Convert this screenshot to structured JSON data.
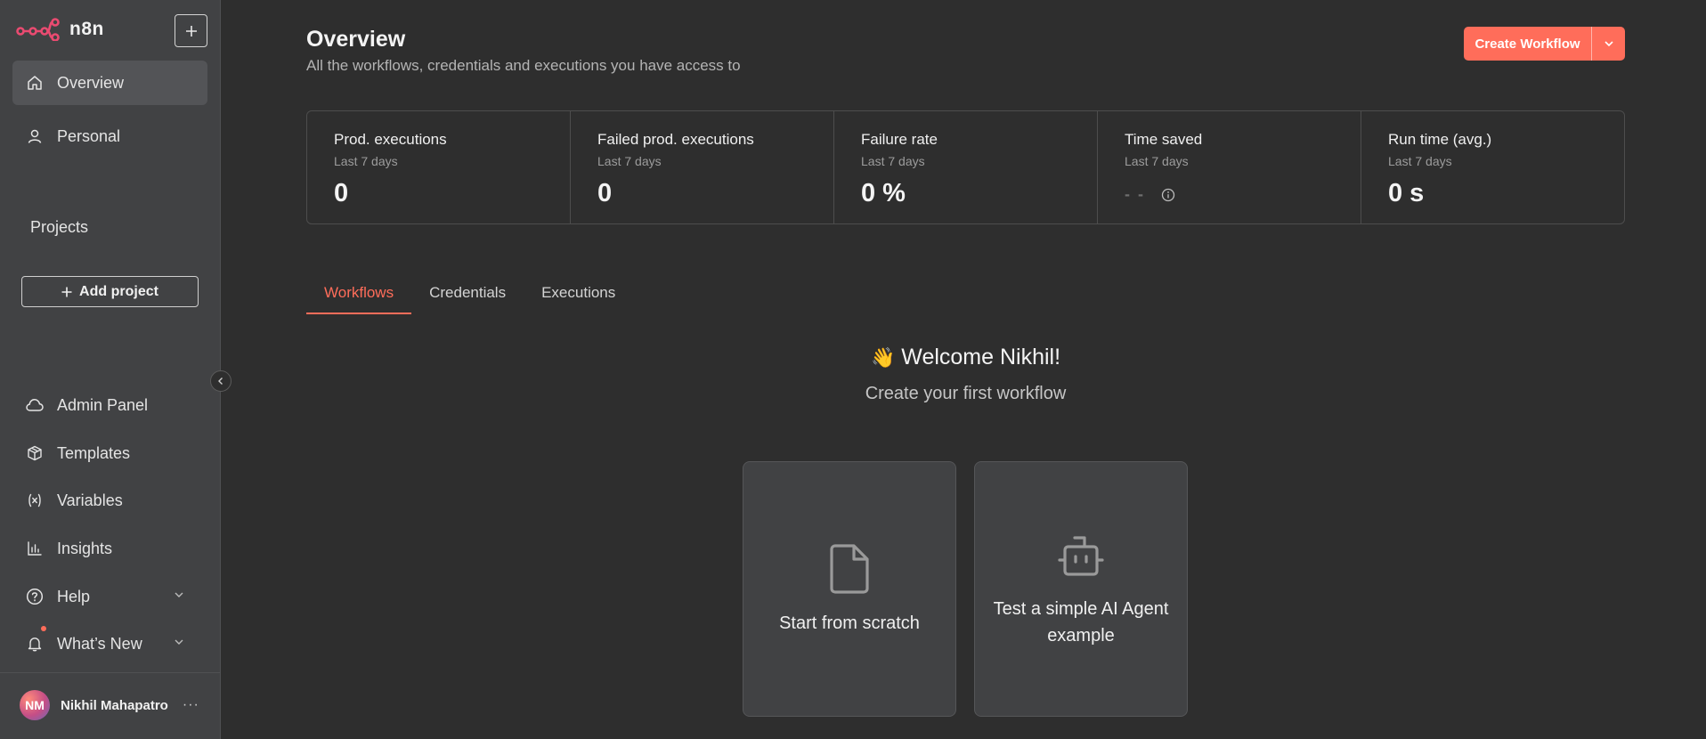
{
  "app": {
    "logo_text": "n8n",
    "accent_color": "#ff6d5a"
  },
  "sidebar": {
    "new_button_icon": "plus-icon",
    "nav_top": [
      {
        "label": "Overview",
        "icon": "home-icon",
        "active": true
      },
      {
        "label": "Personal",
        "icon": "user-icon",
        "active": false
      }
    ],
    "projects_label": "Projects",
    "add_project_label": "Add project",
    "nav_bottom": [
      {
        "label": "Admin Panel",
        "icon": "cloud-icon"
      },
      {
        "label": "Templates",
        "icon": "box-icon"
      },
      {
        "label": "Variables",
        "icon": "variables-icon"
      },
      {
        "label": "Insights",
        "icon": "bar-chart-icon"
      },
      {
        "label": "Help",
        "icon": "help-circle-icon"
      },
      {
        "label": "What’s New",
        "icon": "bell-icon"
      }
    ],
    "user": {
      "initials": "NM",
      "name": "Nikhil Mahapatro",
      "more": "···"
    }
  },
  "header": {
    "title": "Overview",
    "subtitle": "All the workflows, credentials and executions you have access to",
    "create_button": "Create Workflow"
  },
  "stats": [
    {
      "title": "Prod. executions",
      "period": "Last 7 days",
      "value": "0"
    },
    {
      "title": "Failed prod. executions",
      "period": "Last 7 days",
      "value": "0"
    },
    {
      "title": "Failure rate",
      "period": "Last 7 days",
      "value": "0 %"
    },
    {
      "title": "Time saved",
      "period": "Last 7 days",
      "value": "- -"
    },
    {
      "title": "Run time (avg.)",
      "period": "Last 7 days",
      "value": "0 s"
    }
  ],
  "tabs": [
    {
      "label": "Workflows",
      "active": true
    },
    {
      "label": "Credentials",
      "active": false
    },
    {
      "label": "Executions",
      "active": false
    }
  ],
  "welcome": {
    "emoji": "👋",
    "title": "Welcome Nikhil!",
    "subtitle": "Create your first workflow"
  },
  "cards": [
    {
      "label": "Start from scratch",
      "icon": "file-icon"
    },
    {
      "label": "Test a simple AI Agent example",
      "icon": "robot-icon"
    }
  ]
}
